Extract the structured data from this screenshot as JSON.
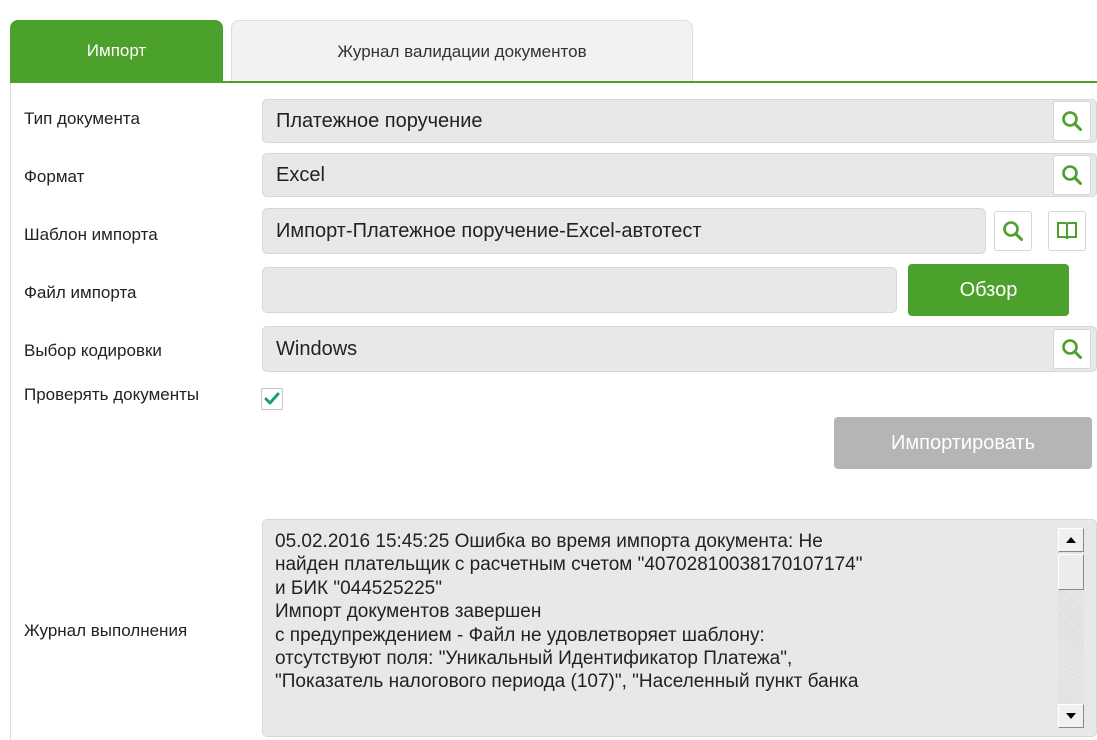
{
  "tabs": {
    "import": "Импорт",
    "validation_log": "Журнал валидации документов"
  },
  "form": {
    "doc_type": {
      "label": "Тип документа",
      "value": "Платежное поручение"
    },
    "format": {
      "label": "Формат",
      "value": "Excel"
    },
    "template": {
      "label": "Шаблон импорта",
      "value": "Импорт-Платежное поручение-Excel-автотест"
    },
    "file": {
      "label": "Файл импорта",
      "value": "",
      "browse_label": "Обзор"
    },
    "encoding": {
      "label": "Выбор кодировки",
      "value": "Windows"
    },
    "validate_docs": {
      "label": "Проверять документы",
      "checked": true
    }
  },
  "import_button": "Импортировать",
  "log": {
    "label": "Журнал выполнения",
    "lines": [
      "05.02.2016 15:45:25 Ошибка во время импорта документа: Не",
      "найден плательщик с расчетным счетом \"40702810038170107174\"",
      "и БИК \"044525225\"",
      "Импорт документов завершен",
      "с предупреждением - Файл не удовлетворяет шаблону:",
      "отсутствуют поля: \"Уникальный Идентификатор Платежа\",",
      "\"Показатель налогового периода (107)\", \"Населенный пункт банка"
    ]
  },
  "colors": {
    "accent": "#4ca02c",
    "field_bg": "#e8e8e8",
    "disabled_button": "#b5b5b5",
    "checkmark": "#1e9e6e"
  },
  "icons": {
    "lookup": "search-icon",
    "template_view": "book-icon",
    "checkbox_mark": "checkmark-icon",
    "scroll_up": "arrow-up-icon",
    "scroll_down": "arrow-down-icon"
  }
}
